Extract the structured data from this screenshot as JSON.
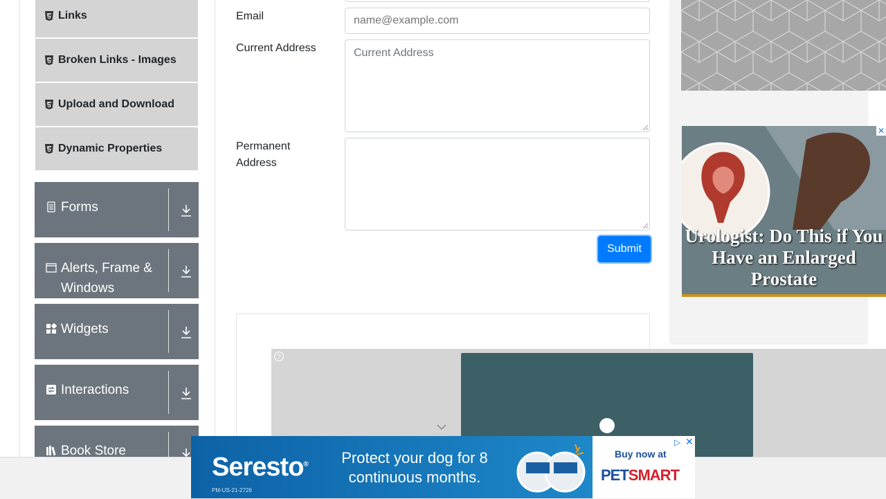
{
  "sidebar": {
    "elements_subitems": [
      {
        "label": "Links"
      },
      {
        "label": "Broken Links - Images"
      },
      {
        "label": "Upload and Download"
      },
      {
        "label": "Dynamic Properties"
      }
    ],
    "groups": [
      {
        "label": "Forms",
        "icon": "form-icon"
      },
      {
        "label": "Alerts, Frame & Windows",
        "icon": "window-icon"
      },
      {
        "label": "Widgets",
        "icon": "widgets-icon"
      },
      {
        "label": "Interactions",
        "icon": "interactions-icon"
      },
      {
        "label": "Book Store",
        "icon": "books-icon"
      }
    ]
  },
  "form": {
    "email_label": "Email",
    "email_placeholder": "name@example.com",
    "current_address_label": "Current Address",
    "current_address_placeholder": "Current Address",
    "permanent_address_label": "Permanent Address",
    "submit_label": "Submit"
  },
  "ads": {
    "urologist_headline": "Urologist: Do This if You Have an Enlarged Prostate",
    "banner_brand": "Seresto",
    "banner_code": "PM-US-21-2726",
    "banner_tagline": "Protect your dog for 8 continuous months.",
    "banner_buy": "Buy now at",
    "banner_store_a": "PET",
    "banner_store_b": "SMART"
  },
  "colors": {
    "primary": "#007bff",
    "group_bg": "#6c757d",
    "subitem_bg": "#d4d4d4"
  }
}
